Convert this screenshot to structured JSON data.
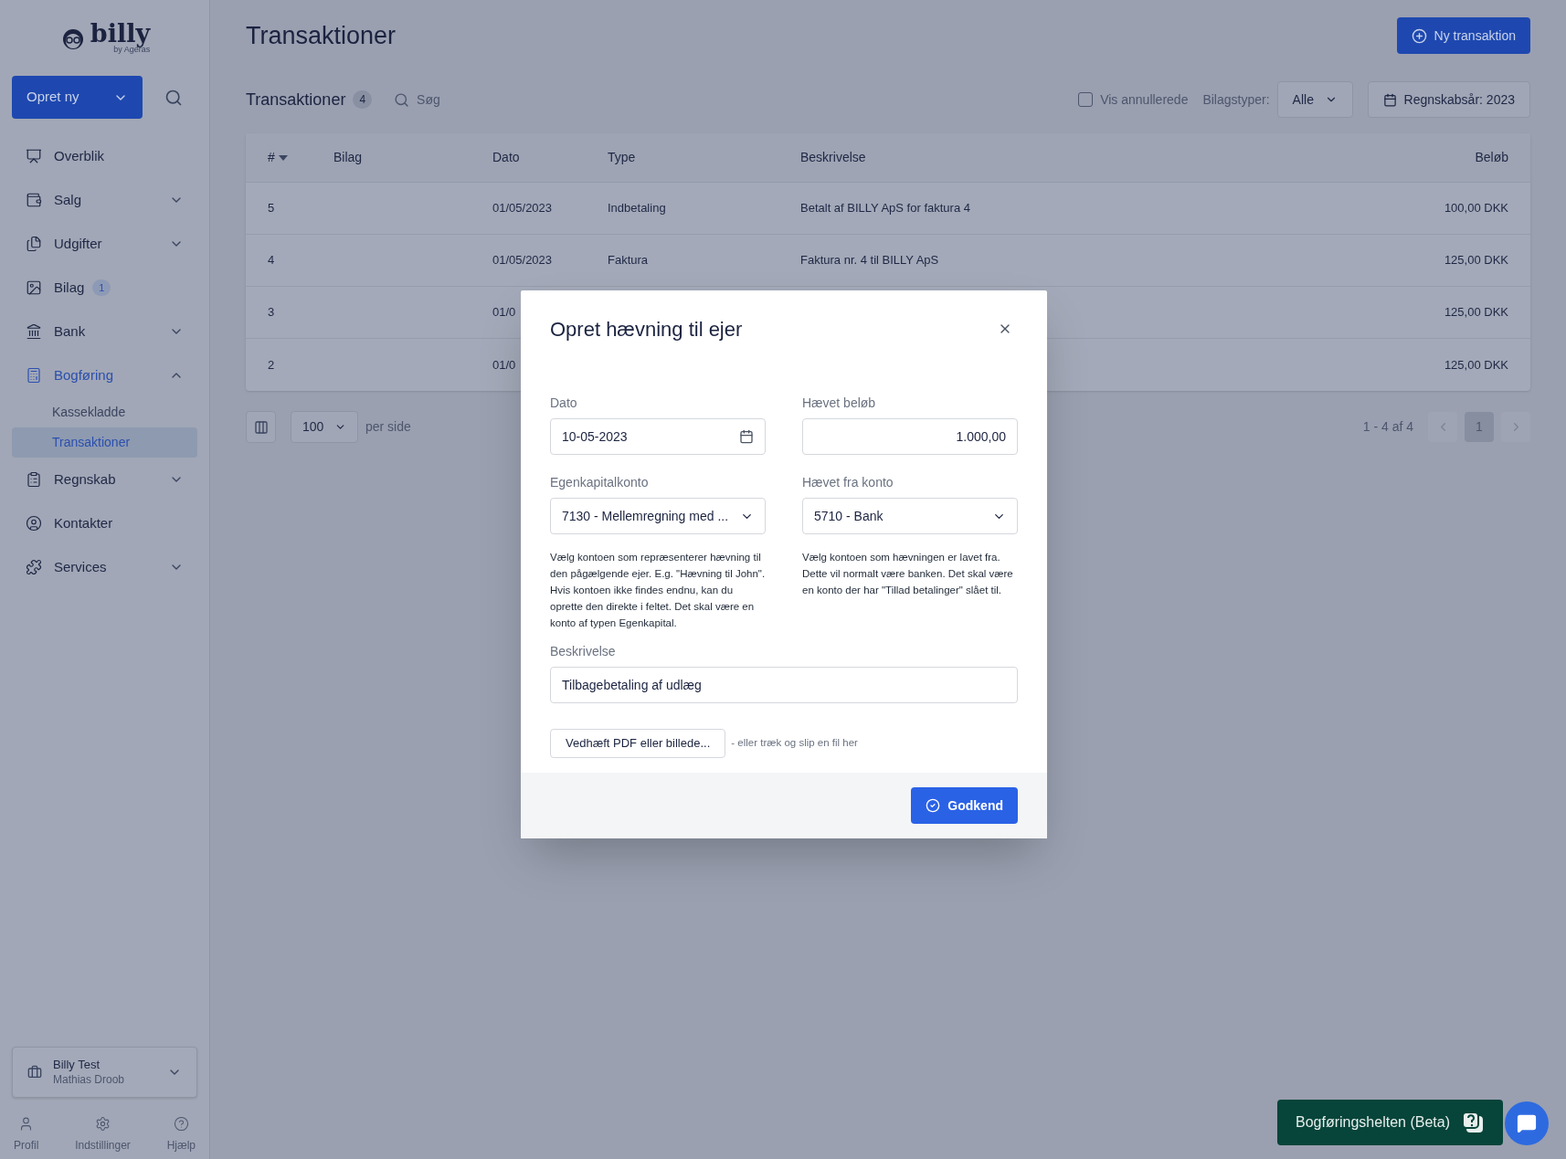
{
  "sidebar": {
    "logo": {
      "wordmark": "billy",
      "tagline": "by Ageras"
    },
    "create_button": "Opret ny",
    "items": [
      {
        "kind": "link",
        "label": "Overblik",
        "selected": false
      },
      {
        "kind": "group",
        "label": "Salg",
        "expanded": false,
        "selected": false
      },
      {
        "kind": "group",
        "label": "Udgifter",
        "expanded": false,
        "selected": false
      },
      {
        "kind": "link",
        "label": "Bilag",
        "badge": "1",
        "selected": false
      },
      {
        "kind": "group",
        "label": "Bank",
        "expanded": false,
        "selected": false
      },
      {
        "kind": "group",
        "label": "Bogføring",
        "expanded": true,
        "selected": true,
        "children": [
          {
            "label": "Kassekladde",
            "selected": false
          },
          {
            "label": "Transaktioner",
            "selected": true
          }
        ]
      },
      {
        "kind": "group",
        "label": "Regnskab",
        "expanded": false,
        "selected": false
      },
      {
        "kind": "link",
        "label": "Kontakter",
        "selected": false
      },
      {
        "kind": "group",
        "label": "Services",
        "expanded": false,
        "selected": false
      }
    ],
    "organization": {
      "name": "Billy Test",
      "user": "Mathias Droob"
    },
    "footer": [
      "Profil",
      "Indstillinger",
      "Hjælp"
    ]
  },
  "page": {
    "title": "Transaktioner",
    "primary_button": "Ny transaktion"
  },
  "toolbar": {
    "title": "Transaktioner",
    "count": "4",
    "search_placeholder": "Søg",
    "show_voided": {
      "label": "Vis annullerede",
      "checked": false
    },
    "type_filter": {
      "label": "Bilagstyper:",
      "value": "Alle"
    },
    "year_button": "Regnskabsår: 2023"
  },
  "table": {
    "columns": [
      "#",
      "Bilag",
      "Dato",
      "Type",
      "Beskrivelse",
      "Beløb"
    ],
    "rows": [
      {
        "number": "5",
        "date": "01/05/2023",
        "type": "Indbetaling",
        "description": "Betalt af BILLY ApS for faktura 4",
        "amount": "100,00 DKK"
      },
      {
        "number": "4",
        "date": "01/05/2023",
        "type": "Faktura",
        "description": "Faktura nr. 4 til BILLY ApS",
        "amount": "125,00 DKK"
      },
      {
        "number": "3",
        "date": "01/0",
        "amount": "125,00 DKK"
      },
      {
        "number": "2",
        "date": "01/0",
        "amount": "125,00 DKK"
      }
    ]
  },
  "pagination": {
    "per_page": "100",
    "per_page_label": "per side",
    "range": "1 - 4 af 4",
    "pages": [
      {
        "label": "1",
        "selected": true
      }
    ]
  },
  "dialog": {
    "title": "Opret hævning til ejer",
    "date": {
      "label": "Dato",
      "value": "10-05-2023"
    },
    "amount": {
      "label": "Hævet beløb",
      "value": "1.000,00"
    },
    "equity_account": {
      "label": "Egenkapitalkonto",
      "value": "7130 - Mellemregning med ...",
      "help": "Vælg kontoen som repræsenterer hævning til den pågælgende ejer. E.g. \"Hævning til John\". Hvis kontoen ikke findes endnu, kan du oprette den direkte i feltet. Det skal være en konto af typen Egenkapital."
    },
    "from_account": {
      "label": "Hævet fra konto",
      "value": "5710 - Bank",
      "help": "Vælg kontoen som hævningen er lavet fra. Dette vil normalt være banken. Det skal være en konto der har \"Tillad betalinger\" slået til."
    },
    "description": {
      "label": "Beskrivelse",
      "value": "Tilbagebetaling af udlæg"
    },
    "attach_button": "Vedhæft PDF eller billede...",
    "attach_hint": "- eller træk og slip en fil her",
    "approve_button": "Godkend"
  },
  "helper_button": "Bogføringshelten (Beta)"
}
